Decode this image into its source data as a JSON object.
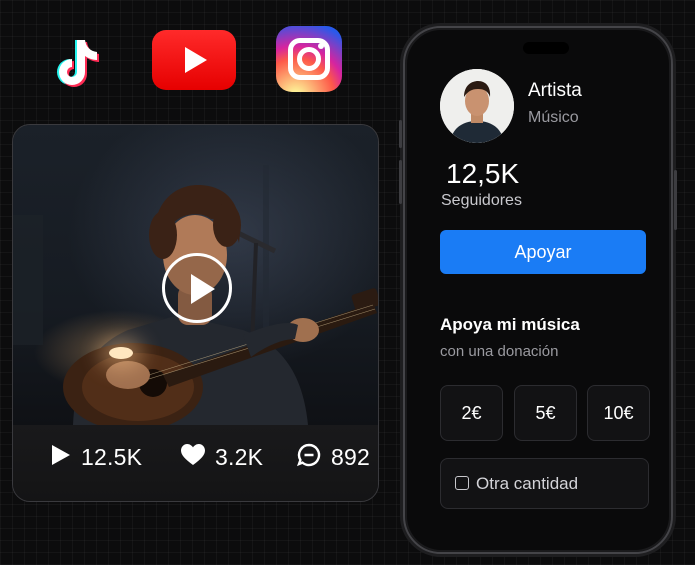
{
  "social_icons": [
    "tiktok-icon",
    "youtube-icon",
    "instagram-icon"
  ],
  "video": {
    "stats": {
      "plays": "12.5K",
      "likes": "3.2K",
      "comments": "892"
    }
  },
  "profile": {
    "name": "Artista",
    "role": "Músico",
    "followers_count": "12,5K",
    "followers_label": "Seguidores",
    "support_button": "Apoyar"
  },
  "donation": {
    "title": "Apoya mi música",
    "subtitle": "con una donación",
    "amounts": [
      "2€",
      "5€",
      "10€"
    ],
    "other_label": "Otra cantidad"
  },
  "colors": {
    "accent_blue": "#1a7cf5",
    "background": "#0c0c0d"
  }
}
